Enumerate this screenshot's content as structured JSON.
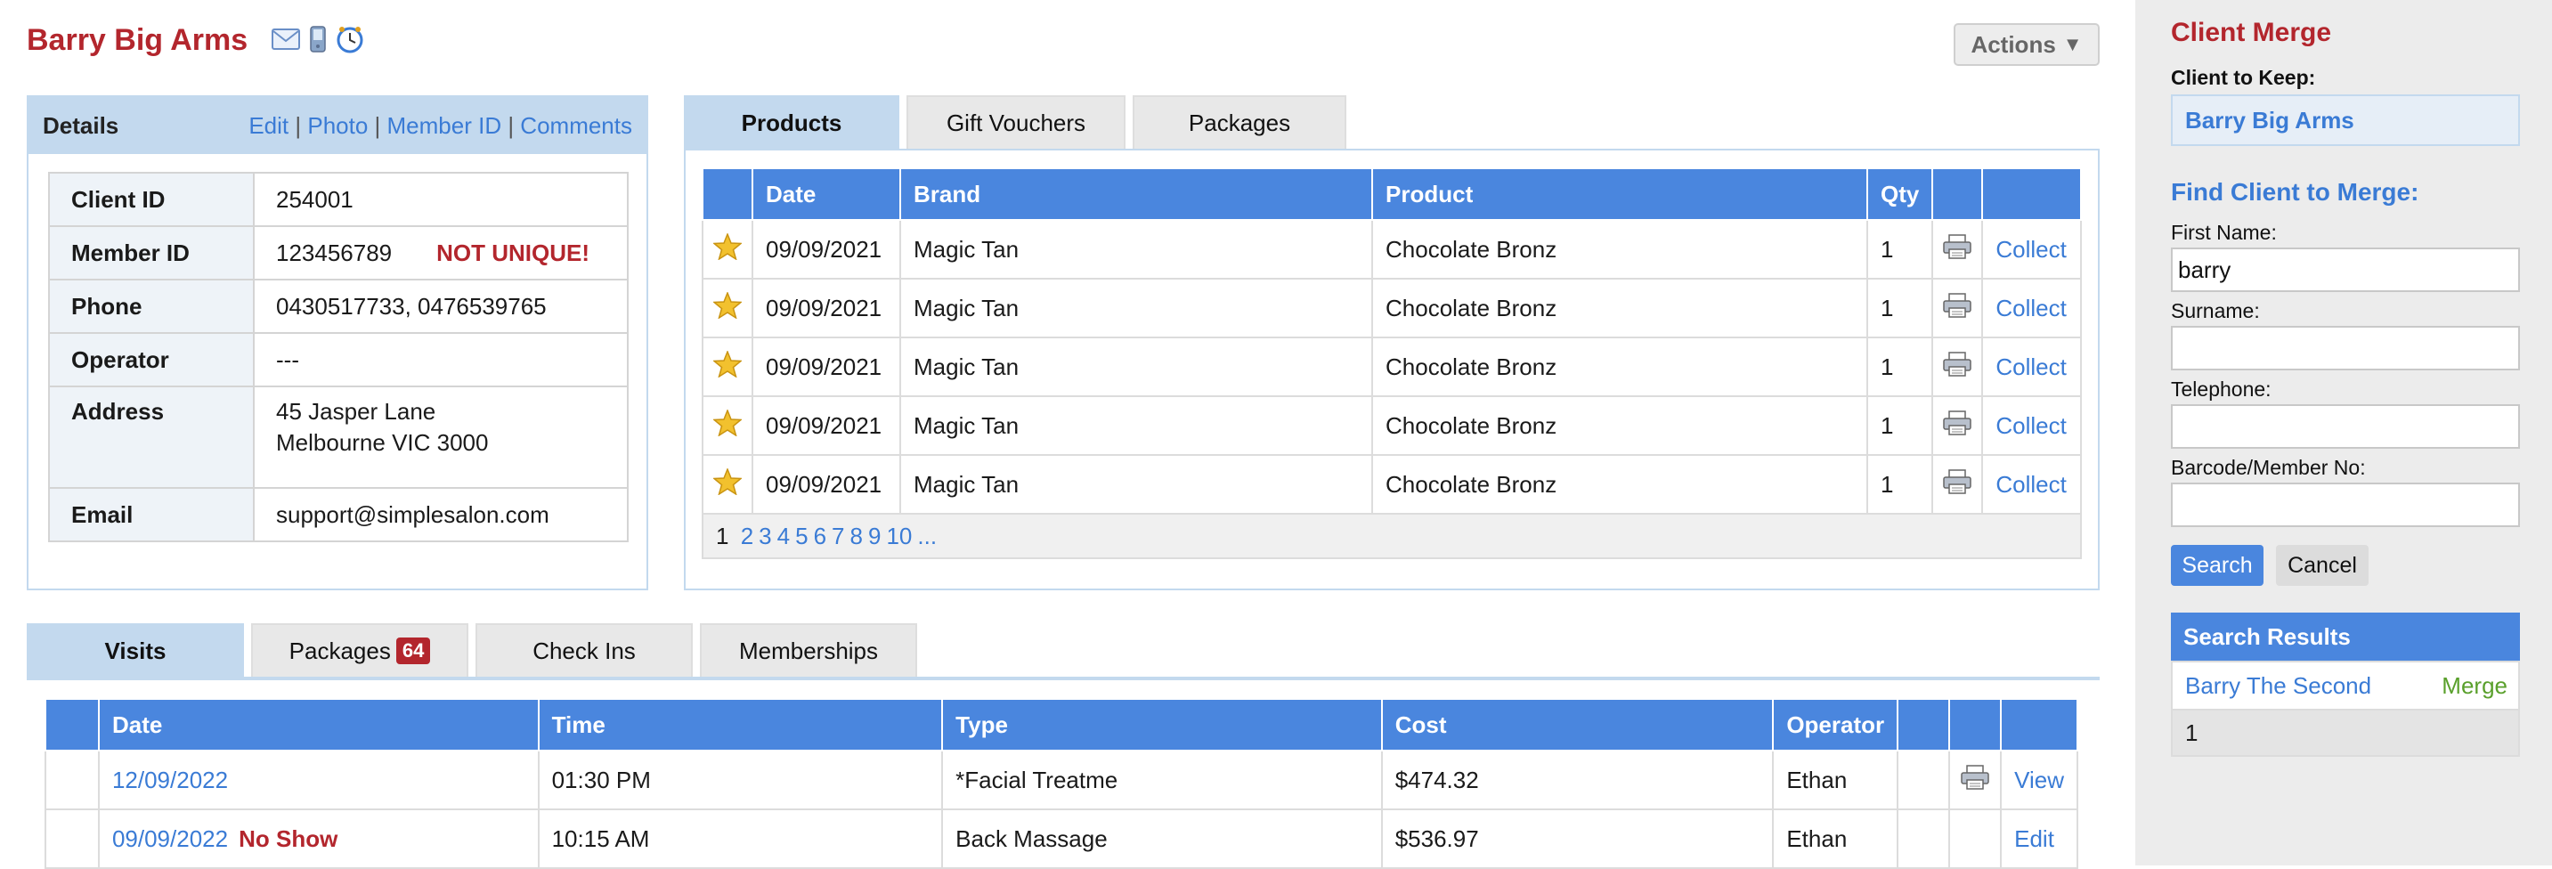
{
  "client": {
    "name": "Barry Big Arms"
  },
  "actions": {
    "label": "Actions",
    "arrow": "▼"
  },
  "details": {
    "title": "Details",
    "links": [
      "Edit",
      "Photo",
      "Member ID",
      "Comments"
    ],
    "rows": {
      "client_id": {
        "label": "Client ID",
        "value": "254001"
      },
      "member_id": {
        "label": "Member ID",
        "value": "123456789",
        "flag": "NOT UNIQUE!"
      },
      "phone": {
        "label": "Phone",
        "value": "0430517733, 0476539765"
      },
      "operator": {
        "label": "Operator",
        "value": "---"
      },
      "address": {
        "label": "Address",
        "line1": "45 Jasper Lane",
        "line2": "Melbourne VIC 3000"
      },
      "email": {
        "label": "Email",
        "value": "support@simplesalon.com"
      }
    }
  },
  "product_tabs": [
    "Products",
    "Gift Vouchers",
    "Packages"
  ],
  "products": {
    "columns": [
      "",
      "Date",
      "Brand",
      "Product",
      "Qty",
      "",
      ""
    ],
    "rows": [
      {
        "date": "09/09/2021",
        "brand": "Magic Tan",
        "product": "Chocolate Bronz",
        "qty": "1",
        "action": "Collect"
      },
      {
        "date": "09/09/2021",
        "brand": "Magic Tan",
        "product": "Chocolate Bronz",
        "qty": "1",
        "action": "Collect"
      },
      {
        "date": "09/09/2021",
        "brand": "Magic Tan",
        "product": "Chocolate Bronz",
        "qty": "1",
        "action": "Collect"
      },
      {
        "date": "09/09/2021",
        "brand": "Magic Tan",
        "product": "Chocolate Bronz",
        "qty": "1",
        "action": "Collect"
      },
      {
        "date": "09/09/2021",
        "brand": "Magic Tan",
        "product": "Chocolate Bronz",
        "qty": "1",
        "action": "Collect"
      }
    ],
    "pager": {
      "current": "1",
      "pages": [
        "2",
        "3",
        "4",
        "5",
        "6",
        "7",
        "8",
        "9",
        "10",
        "..."
      ]
    }
  },
  "visit_tabs": {
    "visits": "Visits",
    "packages": "Packages",
    "packages_count": "64",
    "checkins": "Check Ins",
    "memberships": "Memberships"
  },
  "visits": {
    "columns": [
      "",
      "Date",
      "Time",
      "Type",
      "Cost",
      "Operator",
      "",
      "",
      ""
    ],
    "rows": [
      {
        "date": "12/09/2022",
        "flag": "",
        "time": "01:30 PM",
        "type": "*Facial Treatme",
        "cost": "$474.32",
        "operator": "Ethan",
        "action": "View"
      },
      {
        "date": "09/09/2022",
        "flag": "No Show",
        "time": "10:15 AM",
        "type": "Back Massage",
        "cost": "$536.97",
        "operator": "Ethan",
        "action": "Edit"
      }
    ]
  },
  "merge": {
    "title": "Client Merge",
    "keep_label": "Client to Keep:",
    "keep_value": "Barry Big Arms",
    "find_title": "Find Client to Merge:",
    "first_name_label": "First Name:",
    "first_name_value": "barry",
    "surname_label": "Surname:",
    "telephone_label": "Telephone:",
    "barcode_label": "Barcode/Member No:",
    "search_label": "Search",
    "cancel_label": "Cancel",
    "results_title": "Search Results",
    "result_name": "Barry The Second",
    "result_action": "Merge",
    "results_page": "1"
  },
  "colors": {
    "brand_red": "#b3262d",
    "header_blue": "#4a86de",
    "link_blue": "#3a7bd5",
    "panel_blue": "#c3d9ee",
    "merge_green": "#5aa02c"
  },
  "icons": [
    "email-icon",
    "mobile-icon",
    "clock-icon",
    "star-icon",
    "printer-icon"
  ]
}
